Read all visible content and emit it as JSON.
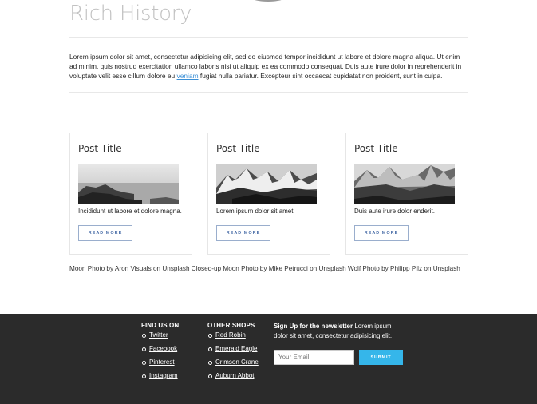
{
  "hero": {
    "title": "Rich History"
  },
  "intro": {
    "text_before_link": "Lorem ipsum dolor sit amet, consectetur adipisicing elit, sed do eiusmod tempor incididunt ut labore et dolore magna aliqua. Ut enim ad minim, quis nostrud exercitation ullamco laboris nisi ut aliquip ex ea commodo consequat. Duis aute irure dolor in reprehenderit in voluptate velit esse cillum dolore eu ",
    "link_text": "veniam",
    "text_after_link": " fugiat nulla pariatur. Excepteur sint occaecat cupidatat non proident, sunt in culpa."
  },
  "posts": [
    {
      "title": "Post Title",
      "excerpt": "Incididunt ut labore et dolore magna.",
      "button": "READ MORE",
      "image": "sea-rocks-photo"
    },
    {
      "title": "Post Title",
      "excerpt": "Lorem ipsum dolor sit amet.",
      "button": "READ MORE",
      "image": "snowy-mountains-photo"
    },
    {
      "title": "Post Title",
      "excerpt": "Duis aute irure dolor enderit.",
      "button": "READ MORE",
      "image": "mountain-valley-photo"
    }
  ],
  "credits": "Moon Photo by Aron Visuals on Unsplash Closed-up Moon Photo by Mike Petrucci on Unsplash Wolf Photo by Philipp Pilz on Unsplash",
  "footer": {
    "find_us": {
      "heading": "FIND US ON",
      "links": [
        "Twitter",
        "Facebook",
        "Pinterest",
        "Instagram"
      ]
    },
    "other_shops": {
      "heading": "OTHER SHOPS",
      "links": [
        "Red Robin",
        "Emerald Eagle",
        "Crimson Crane",
        "Auburn Abbot"
      ]
    },
    "newsletter": {
      "heading": "Sign Up for the newsletter",
      "text": " Lorem ipsum dolor sit amet, consectetur adipisicing elit.",
      "email_placeholder": "Your Email",
      "submit_label": "SUBMIT"
    },
    "colors": {
      "background": "#2b2b2b",
      "submit": "#35b6ea"
    }
  }
}
